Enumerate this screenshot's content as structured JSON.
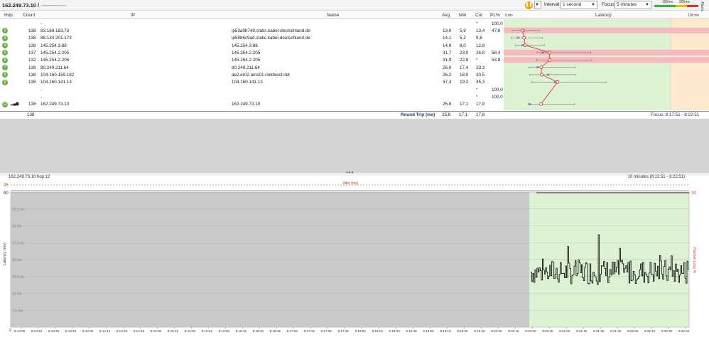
{
  "header": {
    "target": "162.249.73.10 /",
    "target_suffix": "--------------",
    "interval_label": "Interval",
    "interval_value": "1 second",
    "focus_label": "Focus",
    "focus_value": "5 minutes",
    "scale_100": "100ms",
    "scale_200": "200ms",
    "alerts": "Alerts"
  },
  "table": {
    "columns": [
      "Hop",
      "Count",
      "IP",
      "Name",
      "Avg",
      "Min",
      "Cur",
      "PL%"
    ],
    "latency_label": "Latency",
    "latency_min": "0 ms",
    "latency_max": "118 ms",
    "rows": [
      {
        "hop": "",
        "count": "",
        "ip": "-",
        "name": "",
        "avg": "",
        "min": "",
        "cur": "*",
        "pl": "100,0"
      },
      {
        "hop": "2",
        "count": "138",
        "ip": "83.169.183.73",
        "name": "ip53a9b749.static.kabel-deutschland.de",
        "avg": "13,0",
        "min": "5,9",
        "cur": "13,4",
        "pl": "47,8"
      },
      {
        "hop": "3",
        "count": "138",
        "ip": "88.134.201.173",
        "name": "ip5886c9ad.static.kabel-deutschland.de",
        "avg": "14,1",
        "min": "5,2",
        "cur": "9,8",
        "pl": ""
      },
      {
        "hop": "4",
        "count": "138",
        "ip": "145.254.3.88",
        "name": "145.254.3.88",
        "avg": "14,9",
        "min": "8,0",
        "cur": "12,8",
        "pl": ""
      },
      {
        "hop": "5",
        "count": "137",
        "ip": "145.254.2.205",
        "name": "145.254.2.205",
        "avg": "31,7",
        "min": "23,0",
        "cur": "26,8",
        "pl": "58,4"
      },
      {
        "hop": "6",
        "count": "132",
        "ip": "145.254.2.205",
        "name": "145.254.2.205",
        "avg": "31,9",
        "min": "22,8",
        "cur": "*",
        "pl": "53,8"
      },
      {
        "hop": "7",
        "count": "138",
        "ip": "80.249.211.64",
        "name": "80.249.211.64",
        "avg": "26,0",
        "min": "17,4",
        "cur": "23,3",
        "pl": ""
      },
      {
        "hop": "8",
        "count": "138",
        "ip": "104.160.159.182",
        "name": "ae2.er02.ams01.riotdirect.net",
        "avg": "26,2",
        "min": "18,0",
        "cur": "30,5",
        "pl": ""
      },
      {
        "hop": "9",
        "count": "138",
        "ip": "104.160.141.13",
        "name": "104.160.141.13",
        "avg": "37,3",
        "min": "19,2",
        "cur": "35,3",
        "pl": ""
      },
      {
        "hop": "",
        "count": "",
        "ip": "-",
        "name": "",
        "avg": "",
        "min": "",
        "cur": "*",
        "pl": "100,0"
      },
      {
        "hop": "",
        "count": "",
        "ip": "-",
        "name": "",
        "avg": "",
        "min": "",
        "cur": "*",
        "pl": "100,0"
      },
      {
        "hop": "12",
        "count": "138",
        "ip": "162.249.73.10",
        "name": "162.249.73.10",
        "avg": "25,8",
        "min": "17,1",
        "cur": "17,8",
        "pl": ""
      }
    ],
    "footer": {
      "count": "138",
      "label": "Round Trip (ms)",
      "avg": "25,8",
      "min": "17,1",
      "cur": "17,8",
      "focus": "Focus: 8:17:51 - 8:22:51"
    }
  },
  "graph": {
    "title": "162.249.73.10 hop 12",
    "range": "10 minutes (8:12:51 - 8:22:51)",
    "jitter_label": "Jitter (ms)",
    "jitter_value": "35",
    "y_label": "Latency (ms)",
    "y2_label": "Packet Loss %",
    "y_max": "60",
    "y2_max": "30",
    "y_ticks": [
      "52,5 ms",
      "45 ms",
      "37,5 ms",
      "30 ms",
      "22,5 ms",
      "15 ms",
      "7,5 ms"
    ],
    "x_start": "0",
    "x_ticks": [
      "8:13:00",
      "8:13:15",
      "8:13:30",
      "8:13:45",
      "8:14:00",
      "8:14:15",
      "8:14:30",
      "8:14:45",
      "8:15:00",
      "8:15:15",
      "8:15:30",
      "8:15:45",
      "8:16:00",
      "8:16:15",
      "8:16:30",
      "8:16:45",
      "8:17:00",
      "8:17:15",
      "8:17:30",
      "8:17:45",
      "8:18:00",
      "8:18:15",
      "8:18:30",
      "8:18:45",
      "8:19:00",
      "8:19:15",
      "8:19:30",
      "8:19:45",
      "8:20:00",
      "8:20:15",
      "8:20:30",
      "8:20:45",
      "8:21:00",
      "8:21:15",
      "8:21:30",
      "8:21:45",
      "8:22:00",
      "8:22:15",
      "8:22:30",
      "8:22:45"
    ],
    "colors": {
      "data_zone": "#ddf2d3",
      "no_data": "#c9c9c9",
      "loss": "#c0392b",
      "line": "#000000"
    }
  }
}
